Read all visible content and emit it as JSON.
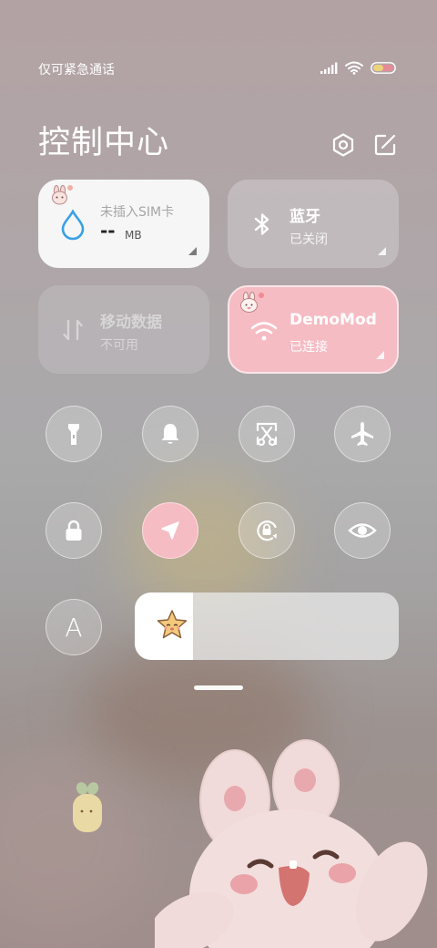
{
  "status_bar": {
    "carrier": "仅可紧急通话",
    "icons": [
      "signal-icon",
      "wifi-icon",
      "battery-icon"
    ]
  },
  "header": {
    "title": "控制中心",
    "buttons": [
      "settings-icon",
      "edit-icon"
    ]
  },
  "tiles": {
    "data_usage": {
      "line1": "未插入SIM卡",
      "value": "--",
      "unit": "MB",
      "icon": "water-drop-icon"
    },
    "bluetooth": {
      "label": "蓝牙",
      "status": "已关闭",
      "icon": "bluetooth-icon"
    },
    "mobile_data": {
      "label": "移动数据",
      "status": "不可用",
      "icon": "data-arrows-icon"
    },
    "wifi": {
      "label": "DemoMod",
      "status": "已连接",
      "icon": "wifi-icon"
    }
  },
  "toggles": [
    {
      "name": "flashlight",
      "icon": "flashlight-icon",
      "active": false
    },
    {
      "name": "bell",
      "icon": "bell-icon",
      "active": false
    },
    {
      "name": "screenshot",
      "icon": "scissors-screenshot-icon",
      "active": false
    },
    {
      "name": "airplane",
      "icon": "airplane-icon",
      "active": false
    },
    {
      "name": "lock",
      "icon": "lock-icon",
      "active": true
    },
    {
      "name": "location",
      "icon": "location-arrow-icon",
      "active": true
    },
    {
      "name": "rotation",
      "icon": "rotation-lock-icon",
      "active": false
    },
    {
      "name": "eye-comfort",
      "icon": "eye-icon",
      "active": false
    },
    {
      "name": "auto-brightness",
      "icon": "letter-a-icon",
      "active": false
    }
  ],
  "auto_brightness_label": "A",
  "brightness": {
    "level": 0.22,
    "icon": "star-face-icon"
  },
  "colors": {
    "accent_pink": "#f6bcc4",
    "data_blue": "#3aa0e6"
  }
}
